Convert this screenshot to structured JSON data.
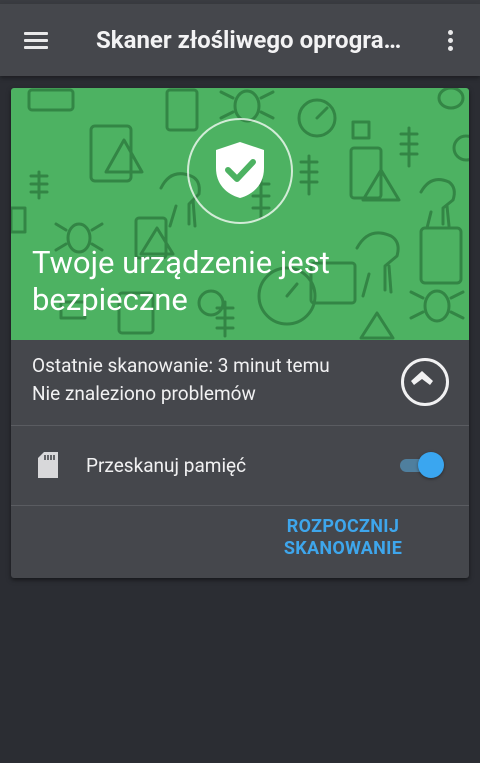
{
  "toolbar": {
    "title": "Skaner złośliwego oprogramowania",
    "menu_icon": "hamburger-menu-icon",
    "more_icon": "more-vert-icon"
  },
  "hero": {
    "status_text": "Twoje urządzenie jest bezpieczne",
    "background_color": "#4db262",
    "icon": "shield-check-icon"
  },
  "scan_status": {
    "last_scan": "Ostatnie skanowanie: 3 minut temu",
    "result": "Nie znaleziono problemów",
    "expand_icon": "chevron-up-circle-icon"
  },
  "memory_option": {
    "label": "Przeskanuj pamięć",
    "icon": "sd-card-icon",
    "enabled": true
  },
  "actions": {
    "start_scan_line1": "ROZPOCZNIJ",
    "start_scan_line2": "SKANOWANIE",
    "accent_color": "#3ea6ec"
  }
}
